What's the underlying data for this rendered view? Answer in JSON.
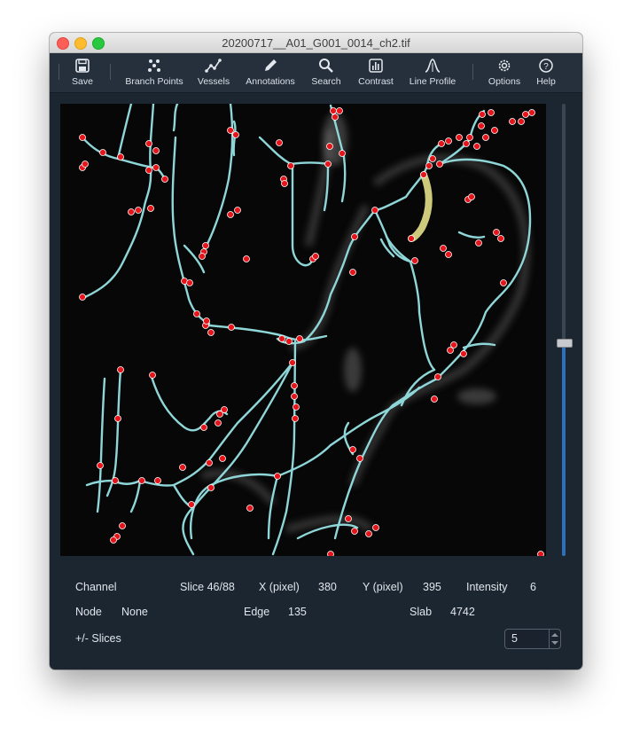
{
  "window": {
    "title": "20200717__A01_G001_0014_ch2.tif"
  },
  "toolbar": {
    "save": {
      "label": "Save",
      "icon": "save-icon"
    },
    "branch_points": {
      "label": "Branch Points",
      "icon": "branch-points-icon"
    },
    "vessels": {
      "label": "Vessels",
      "icon": "vessels-icon"
    },
    "annotations": {
      "label": "Annotations",
      "icon": "pencil-icon"
    },
    "search": {
      "label": "Search",
      "icon": "magnifier-icon"
    },
    "contrast": {
      "label": "Contrast",
      "icon": "histogram-icon"
    },
    "line_profile": {
      "label": "Line Profile",
      "icon": "line-profile-icon"
    },
    "options": {
      "label": "Options",
      "icon": "gear-icon"
    },
    "help": {
      "label": "Help",
      "icon": "question-icon"
    }
  },
  "status": {
    "channel_label": "Channel",
    "slice_label": "Slice 46/88",
    "x_label": "X (pixel)",
    "x_value": "380",
    "y_label": "Y (pixel)",
    "y_value": "395",
    "intensity_label": "Intensity",
    "intensity_value": "6",
    "node_label": "Node",
    "node_value": "None",
    "edge_label": "Edge",
    "edge_value": "135",
    "slab_label": "Slab",
    "slab_value": "4742",
    "slices_label": "+/- Slices",
    "slices_value": "5"
  },
  "slice_slider": {
    "value": 46,
    "max": 88
  },
  "colors": {
    "window_bg": "#1c2631",
    "vessel_tracing": "#8fd6d8",
    "node_marker": "#e8141a",
    "selected_edge": "#e3e08a",
    "slider_fill": "#2f6fb7"
  }
}
